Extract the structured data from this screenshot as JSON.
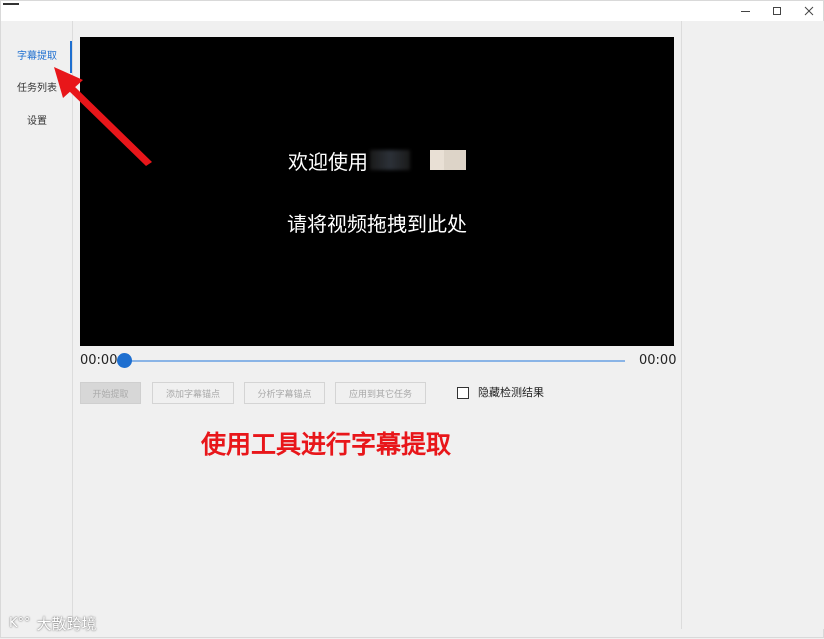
{
  "window": {
    "minimize_icon": "minimize-icon",
    "maximize_icon": "maximize-icon",
    "close_icon": "close-icon"
  },
  "sidebar": {
    "items": [
      {
        "label": "字幕提取",
        "active": true
      },
      {
        "label": "任务列表",
        "active": false
      },
      {
        "label": "设置",
        "active": false
      }
    ],
    "accent_color": "#1e6fd0"
  },
  "player": {
    "welcome_text": "欢迎使用",
    "drop_hint": "请将视频拖拽到此处",
    "time_current": "00:00",
    "time_total": "00:00",
    "progress": 0
  },
  "actions": {
    "start_extract": "开始提取",
    "add_anchor": "添加字幕锚点",
    "analyze_anchor": "分析字幕锚点",
    "apply_other": "应用到其它任务",
    "hide_results_label": "隐藏检测结果",
    "hide_results_checked": false
  },
  "annotation": {
    "text": "使用工具进行字幕提取",
    "color": "#e8161a"
  },
  "watermark": {
    "logo": "K°°",
    "text": "大散跨境"
  }
}
